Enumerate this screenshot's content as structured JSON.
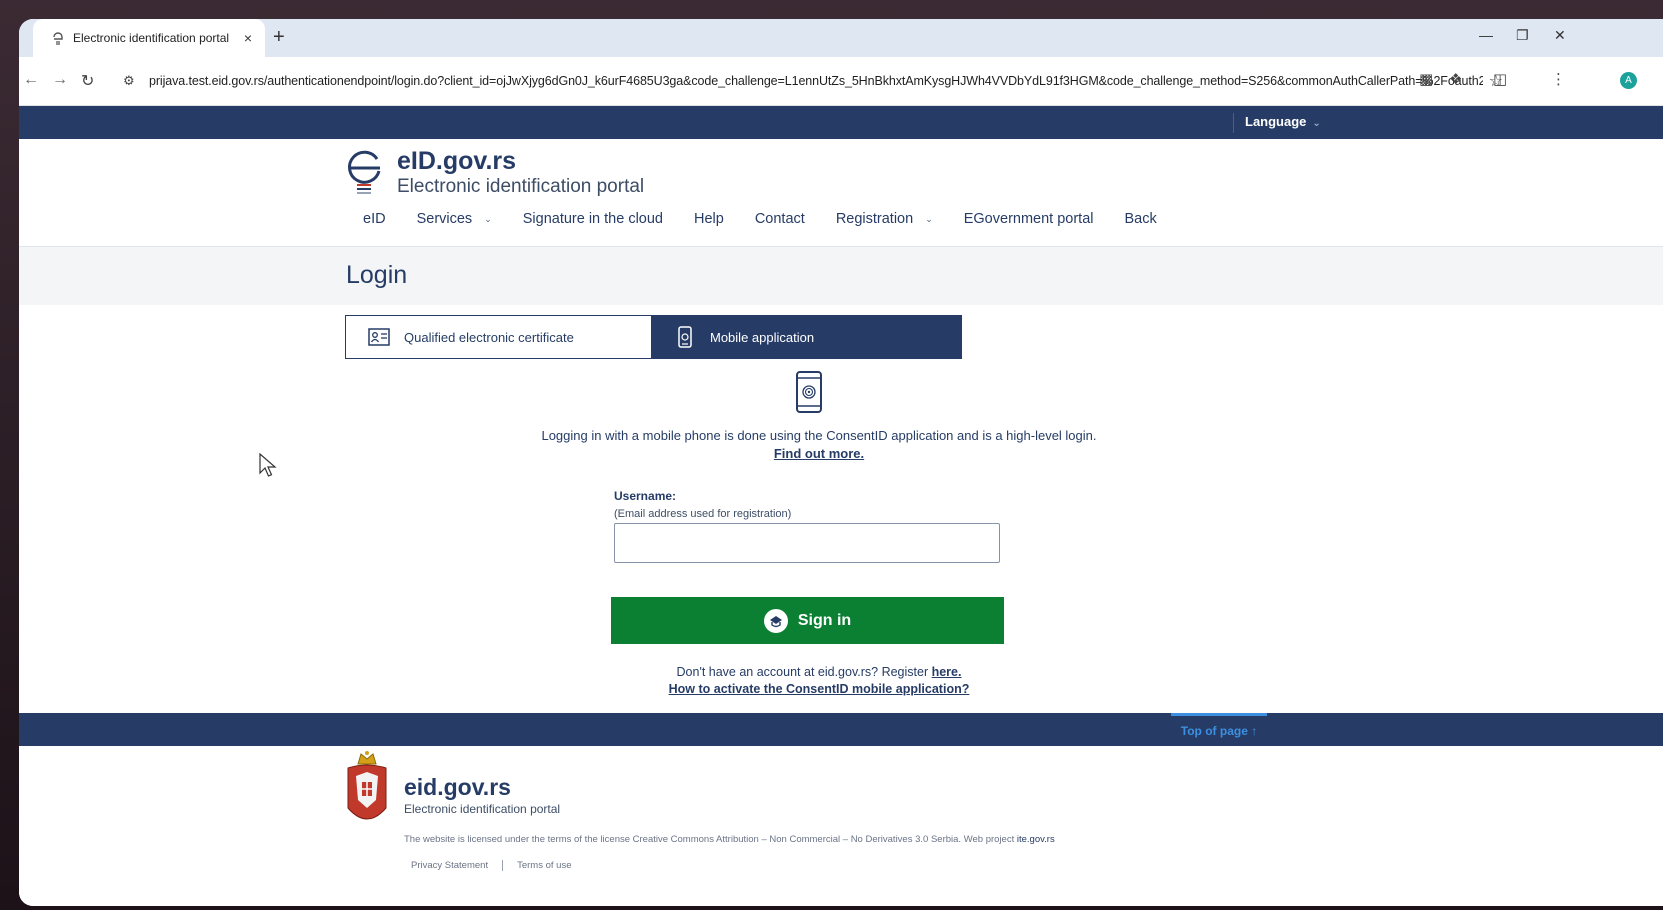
{
  "browser": {
    "tab_title": "Electronic identification portal",
    "tab_close": "×",
    "new_tab": "+",
    "url": "prijava.test.eid.gov.rs/authenticationendpoint/login.do?client_id=ojJwXjyg6dGn0J_k6urF4685U3ga&code_challenge=L1ennUtZs_5HnBkhxtAmKysgHJWh4VVDbYdL91f3HGM&code_challenge_method=S256&commonAuthCallerPath=%2Foauth2...",
    "avatar_letter": "A",
    "icons": [
      "back-icon",
      "forward-icon",
      "reload-icon",
      "site-settings-icon",
      "bookmark-star-icon",
      "cast-icon",
      "extensions-icon",
      "side-panel-icon",
      "profile-avatar",
      "menu-icon"
    ]
  },
  "topbar": {
    "language_label": "Language"
  },
  "header": {
    "logo_title": "eID.gov.rs",
    "logo_subtitle": "Electronic identification portal",
    "nav": [
      {
        "label": "eID",
        "dropdown": false
      },
      {
        "label": "Services",
        "dropdown": true
      },
      {
        "label": "Signature in the cloud",
        "dropdown": false
      },
      {
        "label": "Help",
        "dropdown": false
      },
      {
        "label": "Contact",
        "dropdown": false
      },
      {
        "label": "Registration",
        "dropdown": true
      },
      {
        "label": "EGovernment portal",
        "dropdown": false
      },
      {
        "label": "Back",
        "dropdown": false
      }
    ]
  },
  "login": {
    "title": "Login",
    "tab_certificate": "Qualified electronic certificate",
    "tab_mobile": "Mobile application",
    "info_text": "Logging in with a mobile phone is done using the ConsentID application and is a high-level login.",
    "info_link": "Find out more.",
    "username_label": "Username:",
    "username_hint": "(Email address used for registration)",
    "username_value": "",
    "signin_label": "Sign in",
    "register_text": "Don't have an account at eid.gov.rs? Register ",
    "register_link": "here.",
    "activate_link": "How to activate the ConsentID mobile application?"
  },
  "footer": {
    "top_of_page": "Top of page ↑",
    "title": "eid.gov.rs",
    "subtitle": "Electronic identification portal",
    "license_text": "The website is licensed under the terms of the license Creative Commons Attribution – Non Commercial – No Derivatives 3.0 Serbia. Web project ",
    "license_link": "ite.gov.rs",
    "links": [
      "Privacy Statement",
      "Terms of use"
    ]
  },
  "colors": {
    "navy": "#263c66",
    "green": "#0b8033",
    "accent_blue": "#3d8fe0"
  }
}
